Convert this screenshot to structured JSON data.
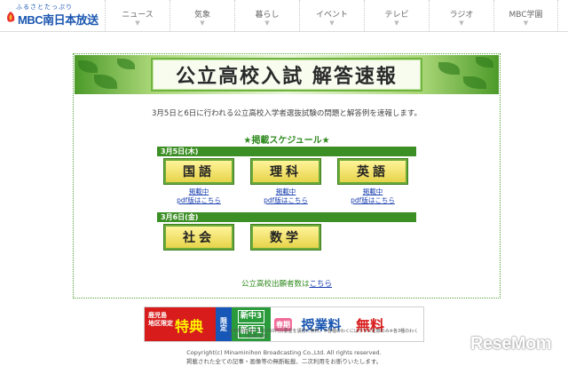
{
  "header": {
    "logo_tagline": "ふるさとたっぷり",
    "logo_name": "MBC南日本放送",
    "nav": [
      {
        "label": "ニュース"
      },
      {
        "label": "気象"
      },
      {
        "label": "暮らし"
      },
      {
        "label": "イベント"
      },
      {
        "label": "テレビ"
      },
      {
        "label": "ラジオ"
      },
      {
        "label": "MBC学園"
      }
    ]
  },
  "banner": {
    "title": "公立高校入試 解答速報"
  },
  "intro": "3月5日と6日に行われる公立高校入学者選抜試験の問題と解答例を速報します。",
  "schedule": {
    "title": "★掲載スケジュール★",
    "days": [
      {
        "date": "3月5日(木)",
        "subjects": [
          {
            "name": "国語",
            "status": "掲載中",
            "pdf": "pdf版はこちら"
          },
          {
            "name": "理科",
            "status": "掲載中",
            "pdf": "pdf版はこちら"
          },
          {
            "name": "英語",
            "status": "掲載中",
            "pdf": "pdf版はこちら"
          }
        ]
      },
      {
        "date": "3月6日(金)",
        "subjects": [
          {
            "name": "社会"
          },
          {
            "name": "数学"
          }
        ]
      }
    ]
  },
  "applicants": {
    "text": "公立高校出願者数は",
    "link": "こちら"
  },
  "ad": {
    "region": "鹿児島\n地区限定",
    "special": "特典",
    "limited": "限定",
    "grade1": "新中3",
    "grade2": "新中1",
    "season": "春期",
    "fee": "授業料",
    "free": "無料",
    "note": "※今年5月までに2,050円分要金を講習に無料。※各種のわくにはクラス在籍のみ※各3種のわくにつく（3/29-3/31）"
  },
  "footer": {
    "copyright": "Copyright(c) Minaminihon Broadcasting Co.,Ltd. All rights reserved.",
    "notice": "掲載された全ての記事・画像等の無断転載、二次利用をお断りいたします。"
  },
  "watermark": "ReseMom",
  "colors": {
    "brand": "#1a56b0",
    "green": "#3c8f24",
    "link": "#1a3fb0",
    "red": "#d81c1c"
  }
}
